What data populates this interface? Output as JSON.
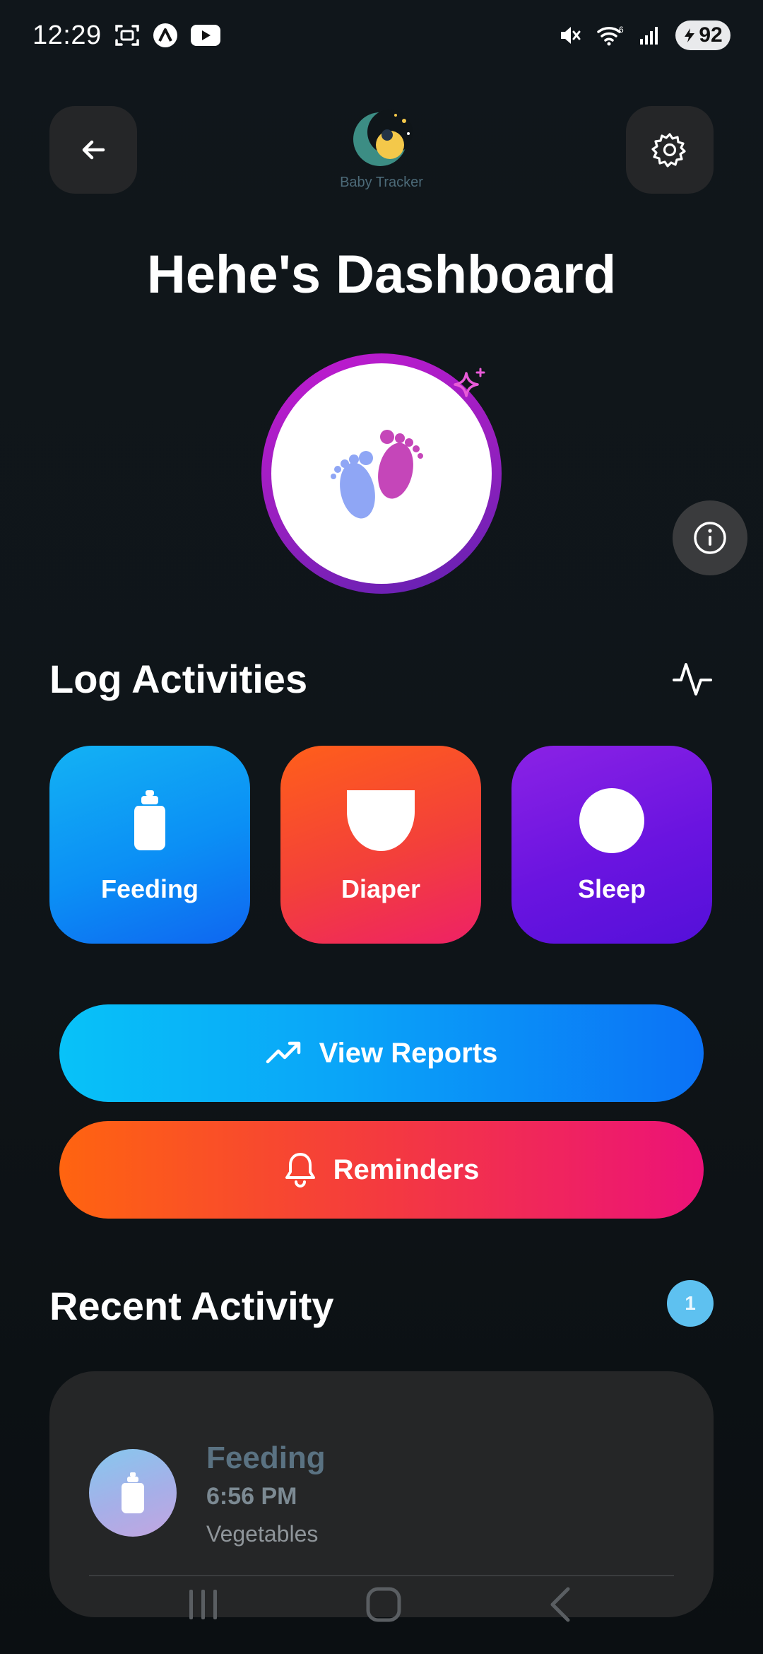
{
  "status_bar": {
    "time": "12:29",
    "battery": "92",
    "icons": [
      "screenshot-icon",
      "app-a-icon",
      "youtube-icon",
      "mute-icon",
      "wifi-icon",
      "signal-icon",
      "battery-icon"
    ]
  },
  "header": {
    "back_icon": "arrow-left-icon",
    "settings_icon": "gear-icon",
    "logo_caption": "Baby Tracker"
  },
  "page": {
    "title": "Hehe's Dashboard"
  },
  "avatar": {
    "icon": "baby-feet-icon",
    "badge_icon": "sparkle-icon"
  },
  "info_icon": "info-icon",
  "log_section": {
    "title": "Log Activities",
    "icon": "activity-pulse-icon",
    "tiles": [
      {
        "label": "Feeding",
        "icon": "bottle-icon",
        "color": "#0b8ff5"
      },
      {
        "label": "Diaper",
        "icon": "diaper-icon",
        "color": "#f3403a"
      },
      {
        "label": "Sleep",
        "icon": "moon-icon",
        "color": "#6a14e0"
      }
    ]
  },
  "actions": {
    "reports_label": "View Reports",
    "reports_icon": "trending-up-icon",
    "reminders_label": "Reminders",
    "reminders_icon": "bell-icon"
  },
  "recent": {
    "title": "Recent Activity",
    "count": "1",
    "items": [
      {
        "type": "Feeding",
        "time": "6:56 PM",
        "detail": "Vegetables",
        "icon": "bottle-icon"
      }
    ]
  },
  "nav": {
    "items": [
      "recent-apps-icon",
      "home-icon",
      "back-icon"
    ]
  },
  "colors": {
    "background": "#0f1418",
    "card": "#252627",
    "accent_blue": "#0a9af6",
    "accent_orange": "#ff6410",
    "accent_pink": "#ec1278",
    "accent_purple": "#6a14e0"
  }
}
